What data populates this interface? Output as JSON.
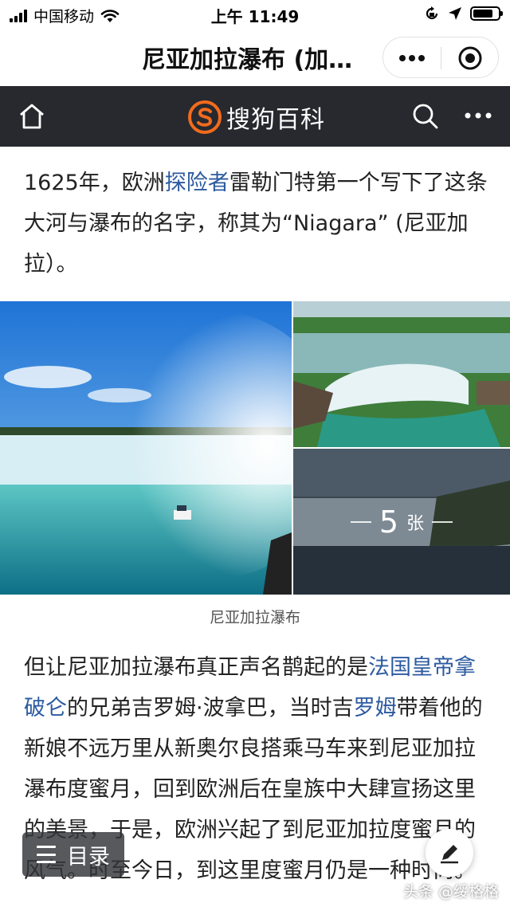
{
  "status_bar": {
    "carrier": "中国移动",
    "time": "上午 11:49",
    "battery_level": 0.8
  },
  "title_bar": {
    "title": "尼亚加拉瀑布 (加…"
  },
  "header": {
    "brand_name": "搜狗百科",
    "brand_color": "#f26b1d",
    "background": "#27292e",
    "icons": [
      "home-icon",
      "search-icon",
      "more-icon"
    ]
  },
  "article": {
    "para1": {
      "t1": "1625年，欧洲",
      "link1": "探险者",
      "t2": "雷勒门特第一个写下了这条大河与瀑布的名字，称其为“Niagara” (尼亚加拉）。"
    },
    "gallery": {
      "count": "5",
      "unit": "张",
      "caption": "尼亚加拉瀑布"
    },
    "para2": {
      "t1": "但让尼亚加拉瀑布真正声名鹊起的是",
      "link1": "法国皇帝拿破仑",
      "t2": "的兄弟吉罗姆·波拿巴，当时吉",
      "link2": "罗姆",
      "t3": "带着他的新娘不远万里从新奥尔良搭乘马车来到尼亚加拉瀑布度蜜月，回到欧洲后在皇族中大肆宣扬这里的美景，于是，欧洲兴起了到尼亚加拉度蜜月的风气。时至今日，到这里度蜜月仍是一种时尚。"
    }
  },
  "floating": {
    "toc_label": "目录",
    "watermark": "头条 @绥格格"
  }
}
